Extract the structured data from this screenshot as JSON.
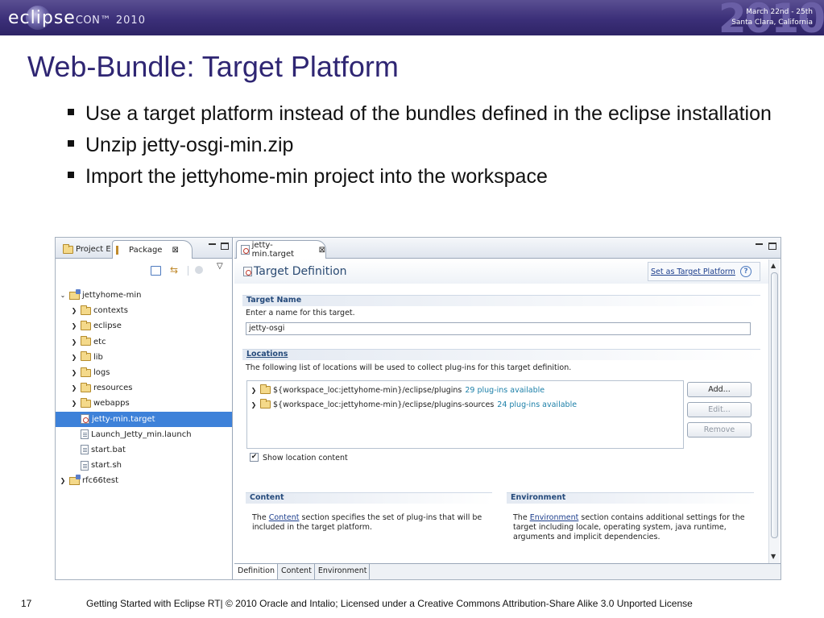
{
  "banner": {
    "logo_main": "eclipse",
    "logo_con": "CON",
    "logo_year": "2010",
    "big_year": "2010",
    "date": "March 22nd - 25th",
    "place": "Santa Clara, California"
  },
  "slide": {
    "title": "Web-Bundle: Target Platform",
    "bullets": [
      "Use a target platform instead of the bundles defined in the eclipse installation",
      "Unzip jetty-osgi-min.zip",
      "Import the jettyhome-min project into the workspace"
    ]
  },
  "left_view": {
    "tabs": [
      "Project E",
      "Package"
    ],
    "tree": [
      {
        "label": "jettyhome-min",
        "expanded": true,
        "level": 0,
        "icon": "project-icon"
      },
      {
        "label": "contexts",
        "level": 1,
        "icon": "folder-icon"
      },
      {
        "label": "eclipse",
        "level": 1,
        "icon": "folder-icon"
      },
      {
        "label": "etc",
        "level": 1,
        "icon": "folder-icon"
      },
      {
        "label": "lib",
        "level": 1,
        "icon": "folder-icon"
      },
      {
        "label": "logs",
        "level": 1,
        "icon": "folder-icon"
      },
      {
        "label": "resources",
        "level": 1,
        "icon": "folder-icon"
      },
      {
        "label": "webapps",
        "level": 1,
        "icon": "folder-icon"
      },
      {
        "label": "jetty-min.target",
        "level": 1,
        "icon": "target-file-icon",
        "selected": true
      },
      {
        "label": "Launch_Jetty_min.launch",
        "level": 1,
        "icon": "launch-file-icon"
      },
      {
        "label": "start.bat",
        "level": 1,
        "icon": "file-icon"
      },
      {
        "label": "start.sh",
        "level": 1,
        "icon": "script-file-icon"
      },
      {
        "label": "rfc66test",
        "level": 0,
        "icon": "project-icon"
      }
    ]
  },
  "editor": {
    "tab": "jetty-min.target",
    "form_title": "Target Definition",
    "set_target_link": "Set as Target Platform",
    "help": "?",
    "target_name": {
      "heading": "Target Name",
      "desc": "Enter a name for this target.",
      "value": "jetty-osgi"
    },
    "locations": {
      "heading": "Locations",
      "desc": "The following list of locations will be used to collect plug-ins for this target definition.",
      "items": [
        {
          "path": "${workspace_loc:jettyhome-min}/eclipse/plugins",
          "available": "29 plug-ins available"
        },
        {
          "path": "${workspace_loc:jettyhome-min}/eclipse/plugins-sources",
          "available": "24 plug-ins available"
        }
      ],
      "buttons": {
        "add": "Add...",
        "edit": "Edit...",
        "remove": "Remove"
      },
      "show_content": "Show location content"
    },
    "content": {
      "heading": "Content",
      "desc_pre": "The ",
      "link": "Content",
      "desc_post": " section specifies the set of plug-ins that will be included in the target platform."
    },
    "environment": {
      "heading": "Environment",
      "desc_pre": "The ",
      "link": "Environment",
      "desc_post": " section contains additional settings for the target including locale, operating system, java runtime, arguments and implicit dependencies."
    },
    "bottom_tabs": [
      "Definition",
      "Content",
      "Environment"
    ]
  },
  "footer": {
    "page": "17",
    "text": "Getting Started with Eclipse RT|  © 2010 Oracle and Intalio; Licensed under a Creative Commons Attribution-Share Alike 3.0 Unported License"
  },
  "colors": {
    "accent": "#2f2673",
    "selection": "#3d81d9",
    "link": "#1b3d8c"
  }
}
